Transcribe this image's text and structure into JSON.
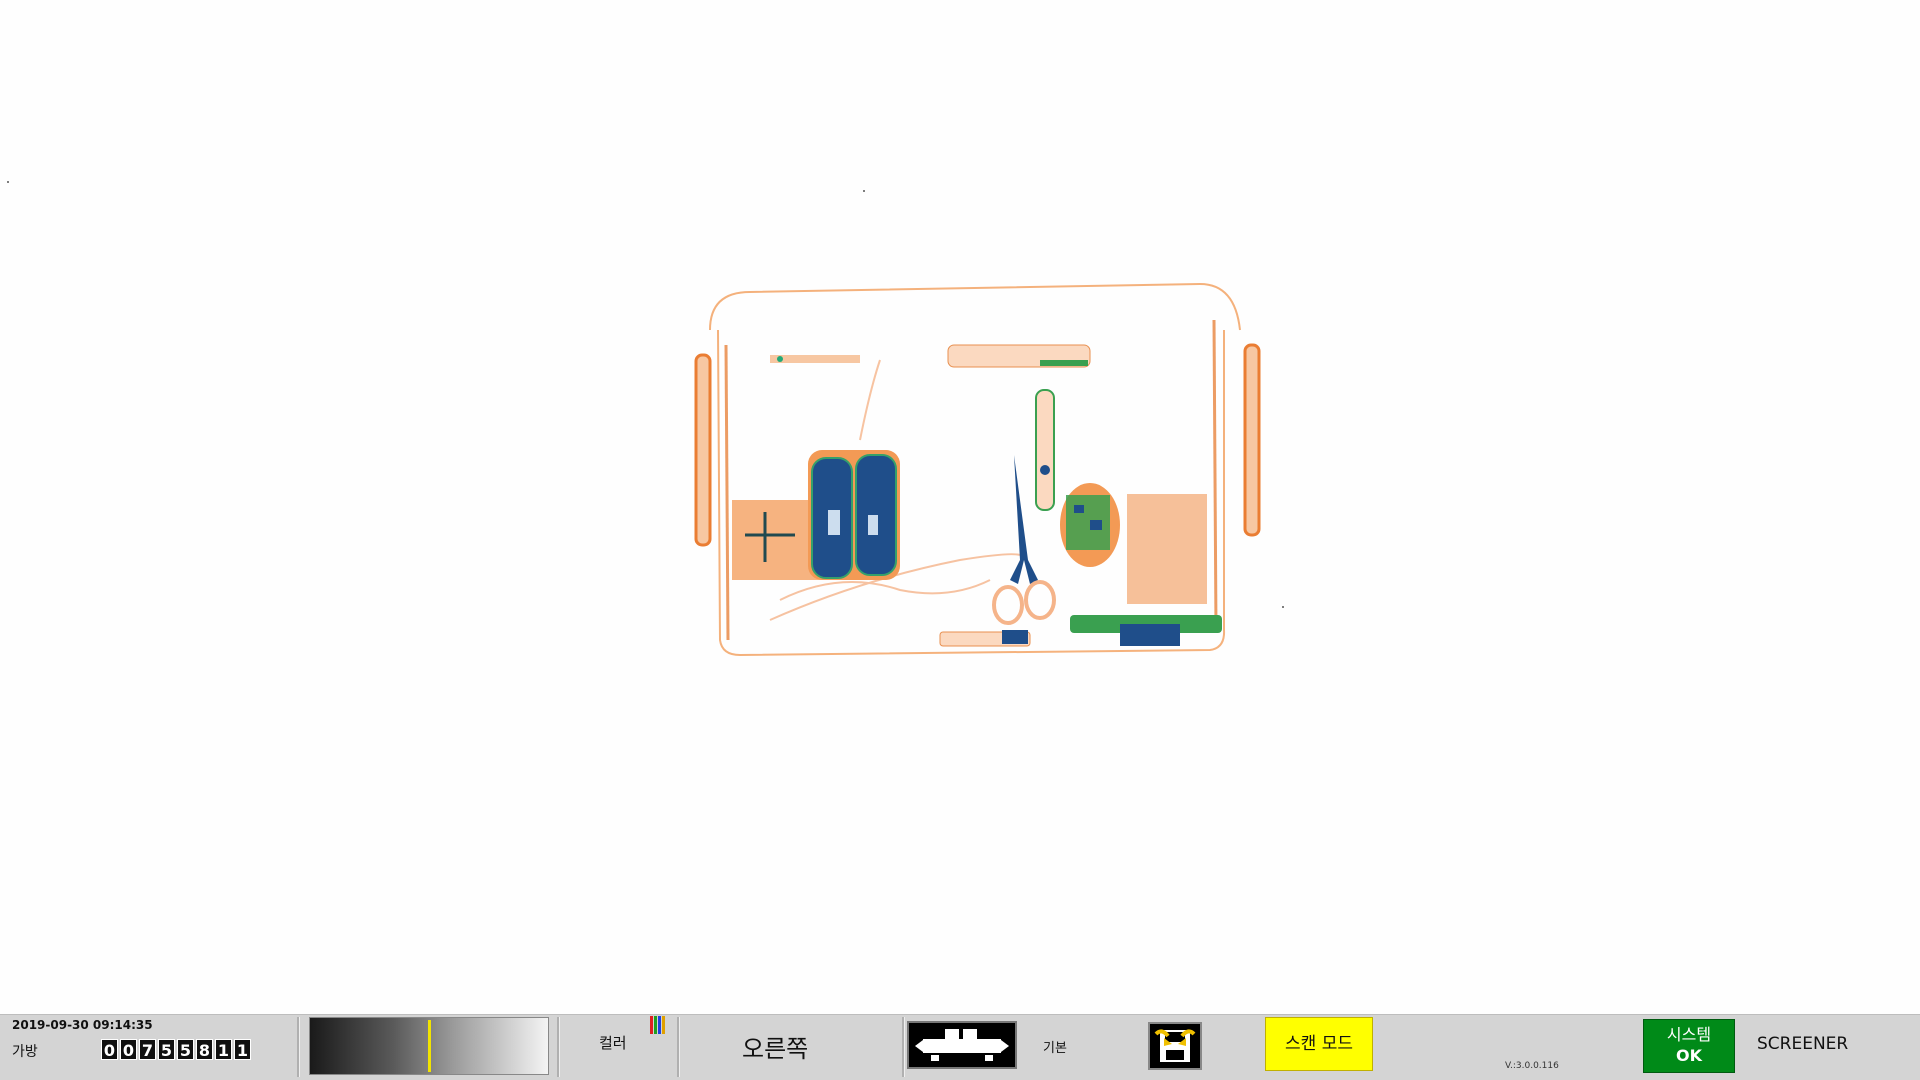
{
  "scan": {
    "object": "x-ray-bag-image"
  },
  "status_bar": {
    "datetime": "2019-09-30 09:14:35",
    "bag_label": "가방",
    "bag_counter": [
      "0",
      "0",
      "7",
      "5",
      "5",
      "8",
      "1",
      "1"
    ],
    "gray_slider_level": 0.5,
    "color_label": "컬러",
    "color_icon_colors": [
      "#e02020",
      "#20a020",
      "#2040e0",
      "#e0a000"
    ],
    "side_label": "오른쪽",
    "conveyor_icon": "conveyor-belt-icon",
    "base_label": "기본",
    "save_icon": "save-disk-icon",
    "scan_mode_label": "스캔 모드",
    "version": "V.:3.0.0.116",
    "system_status_line1": "시스템",
    "system_status_line2": "OK",
    "user_role": "SCREENER"
  },
  "colors": {
    "status_bar_bg": "#d4d4d4",
    "scan_mode_bg": "#ffff00",
    "system_ok_bg": "#008a18",
    "xray_organic": "#f08a3c",
    "xray_metal": "#1f4e8a",
    "xray_mixed": "#3aa050"
  }
}
